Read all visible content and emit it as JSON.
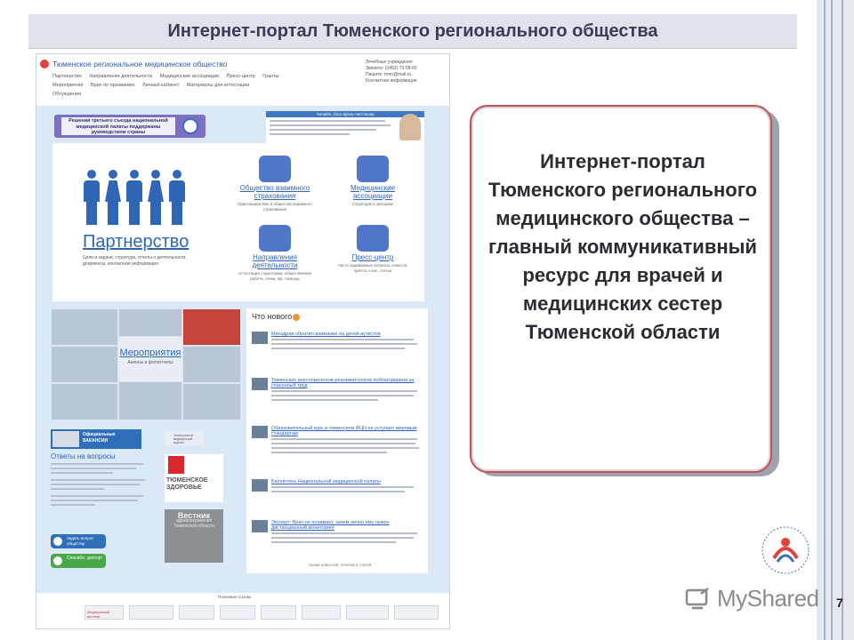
{
  "slide": {
    "title": "Интернет-портал Тюменского регионального общества",
    "number": "7",
    "callout_text": "Интернет-портал Тюменского регионального медицинского общества – главный коммуникативный ресурс для врачей и медицинских сестер Тюменской области"
  },
  "site": {
    "name": "Тюменское региональное медицинское общество",
    "nav_row1": [
      "Партнерство",
      "Направления деятельности",
      "Медицинские ассоциации",
      "Пресс-центр",
      "Гранты"
    ],
    "nav_row2": [
      "Мероприятия",
      "Врач по призванию",
      "Личный кабинет",
      "Материалы для аттестации"
    ],
    "nav_row3": [
      "Обсуждения"
    ],
    "contacts": [
      "Лечебные учреждения",
      "Звоните: (3452) 73-58-65",
      "Пишите: trmo@mail.ru",
      "Контактная информация"
    ],
    "banner_left": "Решения третьего съезда национальной медицинской палаты поддержаны руководством страны",
    "banner_right_top": "Читайте, блог врача Чистякова",
    "partner": {
      "title": "Партнерство",
      "subtitle": "Цели и задачи, структура, отчеты о деятельности, документы, контактная информация"
    },
    "tiles": [
      {
        "label": "Общество взаимного страхования",
        "desc": "Приглашаем Вас в общество взаимного страхования"
      },
      {
        "label": "Медицинские ассоциации",
        "desc": "Структура и описание"
      },
      {
        "label": "Направления деятельности",
        "desc": "Аттестация, подготовка, общественная работа, этика, юр. помощь"
      },
      {
        "label": "Пресс-центр",
        "desc": "Часто задаваемые вопросы, новости, пресса о нас, статьи"
      }
    ],
    "events": {
      "title": "Мероприятия",
      "subtitle": "Анонсы и фотоотчеты"
    },
    "news": {
      "header": "Что нового",
      "items": [
        "Минздрав обратил внимание на детей-аутистов",
        "Тюменских анестезиологов-реаниматологов поблагодарили за спасенный труд",
        "Образовательный курс в тюменском ФЦН не уступает мировым стандартам",
        "Бюллетень Национальной медицинской палаты",
        "Эксперт: Врач не понимает, зачем лично ему нужен дистанционный мониторинг"
      ],
      "more": "Архив новостей, отчётов и статей"
    },
    "vacancies": [
      "Официальные",
      "ВАКАНСИИ"
    ],
    "answers_title": "Ответы на вопросы",
    "ask_button": "Задать вопрос обществу",
    "thanks_button": "Спасибо, доктор!",
    "journal_tag": "Электронный медицинский журнал",
    "tz_title": "ТЮМЕНСКОЕ ЗДОРОВЬЕ",
    "vestnik_title": "Вестник",
    "vestnik_sub": "здравоохранения Тюменской области",
    "footer_label": "Полезные ссылки",
    "footer_logo": "Медицинский вестник"
  },
  "watermark": "MyShared",
  "colors": {
    "accent": "#2f66b6",
    "callout_border": "#c25058",
    "title_band": "#dfe3ec"
  }
}
